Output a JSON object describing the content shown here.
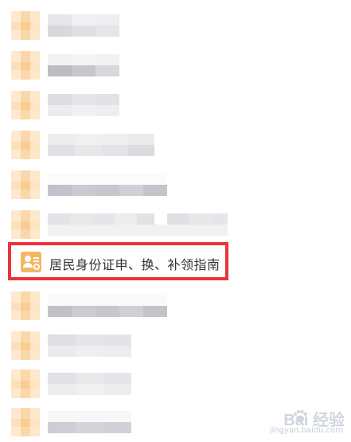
{
  "list": {
    "highlighted_item": {
      "label": "居民身份证申、换、补领指南",
      "icon": "id-card-icon",
      "border_color": "#e8343a",
      "icon_color": "#f3b764"
    }
  },
  "watermark": {
    "brand": "Bai 经验",
    "url": "jingyan.baidu.com"
  }
}
